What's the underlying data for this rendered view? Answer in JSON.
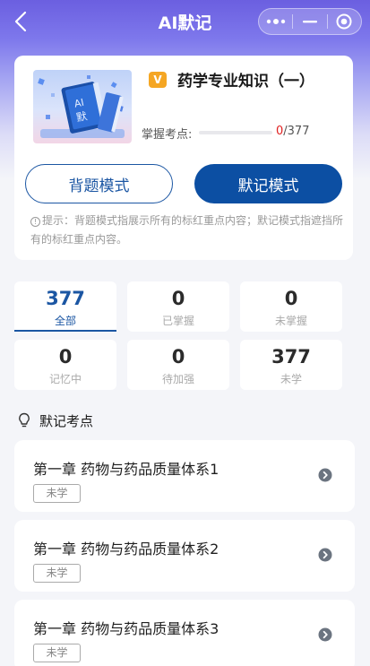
{
  "navbar": {
    "title": "AI默记"
  },
  "course": {
    "badge": "V",
    "title": "药学专业知识（一）",
    "mastery_label": "掌握考点:",
    "mastered": "0",
    "total": "/377",
    "mastery_fraction": 0
  },
  "modes": {
    "recite_label": "背题模式",
    "memo_label": "默记模式"
  },
  "tip": {
    "text": "提示：背题模式指展示所有的标红重点内容；默记模式指遮挡所有的标红重点内容。"
  },
  "stats": [
    {
      "value": "377",
      "label": "全部",
      "active": true
    },
    {
      "value": "0",
      "label": "已掌握"
    },
    {
      "value": "0",
      "label": "未掌握"
    },
    {
      "value": "0",
      "label": "记忆中"
    },
    {
      "value": "0",
      "label": "待加强"
    },
    {
      "value": "377",
      "label": "未学"
    }
  ],
  "section": {
    "title": "默记考点"
  },
  "items": [
    {
      "title": "第一章 药物与药品质量体系1",
      "status": "未学"
    },
    {
      "title": "第一章 药物与药品质量体系2",
      "status": "未学"
    },
    {
      "title": "第一章 药物与药品质量体系3",
      "status": "未学"
    }
  ],
  "colors": {
    "primary": "#0c4fa3",
    "accent_red": "#e02020",
    "badge_orange": "#f5a623"
  }
}
